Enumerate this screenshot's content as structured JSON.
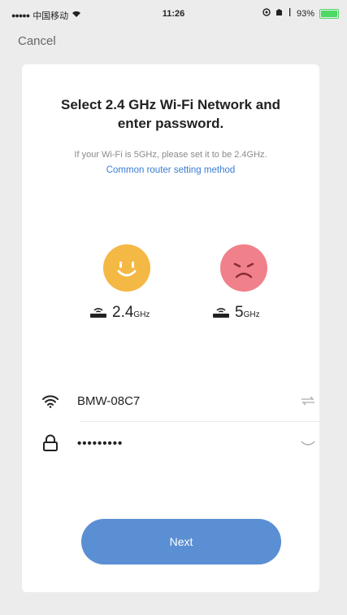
{
  "status_bar": {
    "carrier": "中国移动",
    "time": "11:26",
    "battery": "93%"
  },
  "header": {
    "cancel_label": "Cancel"
  },
  "card": {
    "title_line1": "Select 2.4 GHz Wi-Fi Network and",
    "title_line2": "enter password.",
    "hint": "If your Wi-Fi is 5GHz, please set it to be 2.4GHz.",
    "link": "Common router setting method",
    "bands": [
      {
        "num": "2.4",
        "unit": "GHz",
        "face": "happy-face-icon",
        "color": "#f4b844"
      },
      {
        "num": "5",
        "unit": "GHz",
        "face": "sad-face-icon",
        "color": "#f0808a"
      }
    ],
    "ssid": "BMW-08C7",
    "password": "•••••••••"
  },
  "footer": {
    "next_label": "Next"
  },
  "colors": {
    "accent": "#5b8fd3",
    "link": "#3a7bd5",
    "battery": "#4cd964"
  }
}
